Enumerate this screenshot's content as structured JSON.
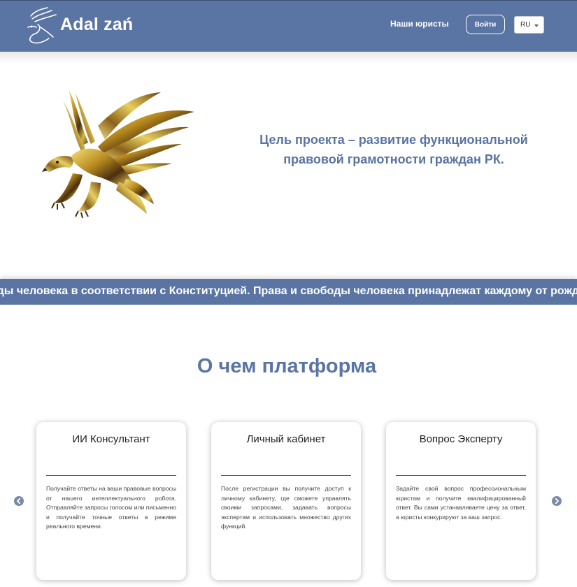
{
  "header": {
    "brand": "Adal zań",
    "nav_lawyers": "Наши юристы",
    "login_label": "Войти",
    "language": "RU",
    "background_color": "#5a74a3"
  },
  "hero": {
    "tagline": "Цель проекта – развитие функциональной правовой грамотности граждан РК.",
    "accent_color": "#5a74a3"
  },
  "marquee": {
    "text": "оды человека в соответствии с Конституцией. Права и свободы человека принадлежат каждому от рожден"
  },
  "platform": {
    "title": "О чем платформа",
    "cards": [
      {
        "title": "ИИ Консультант",
        "text": "Получайте ответы на ваши правовые вопросы от нашего интеллектуального робота. Отправляйте запросы голосом или письменно и получайте точные ответы в режиме реального времени."
      },
      {
        "title": "Личный кабинет",
        "text": "После регистрации вы получите доступ к личному кабинету, где сможете управлять своими запросами, задавать вопросы экспертам и использовать множество других функций."
      },
      {
        "title": "Вопрос Эксперту",
        "text": "Задайте свой вопрос профессиональным юристам и получите квалифицированный ответ. Вы сами устанавливаете цену за ответ, а юристы конкурируют за ваш запрос."
      }
    ],
    "prev_icon": "chevron-left-icon",
    "next_icon": "chevron-right-icon"
  }
}
